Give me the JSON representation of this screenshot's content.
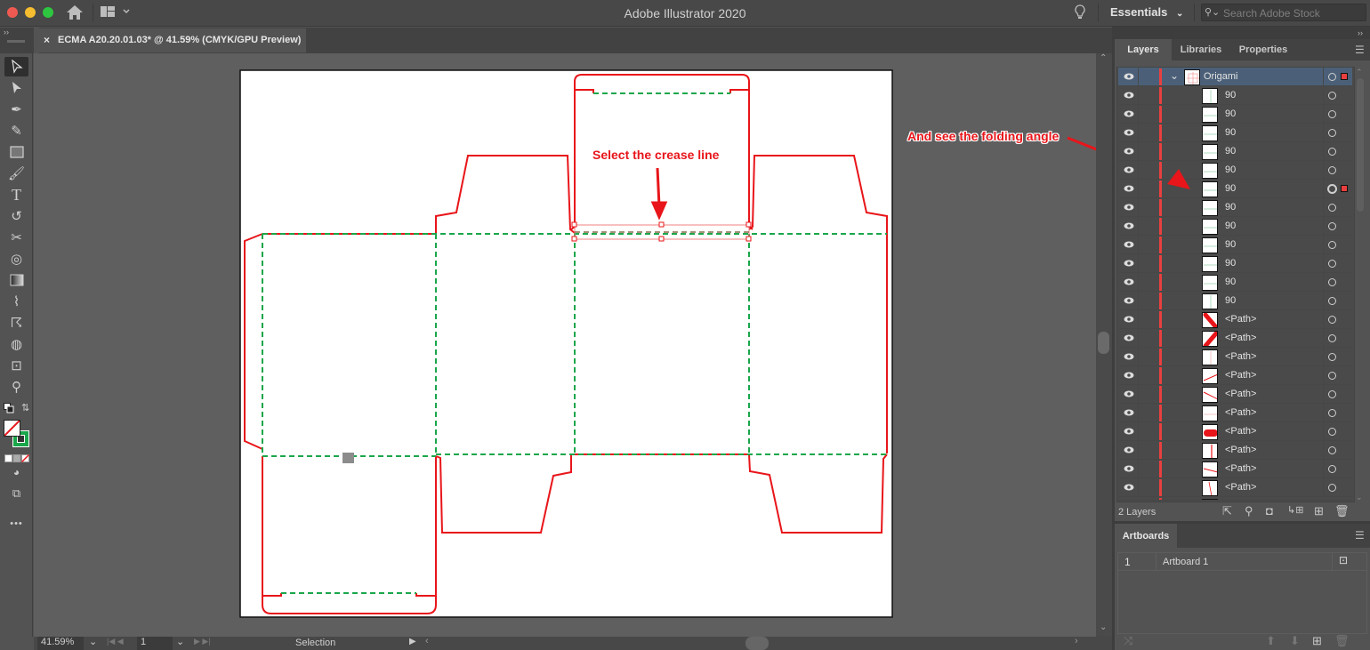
{
  "window": {
    "app_title": "Adobe Illustrator 2020",
    "traffic_lights": {
      "close": "#ee5a52",
      "minimize": "#f5bd2f",
      "maximize": "#2ec640"
    }
  },
  "header": {
    "home_icon": "home-icon",
    "workspace_switcher_icon": "layout-icon",
    "lightbulb_icon": "lightbulb-icon",
    "workspace_label": "Essentials",
    "search_placeholder": "Search Adobe Stock"
  },
  "document_tab": {
    "close_label": "×",
    "title": "ECMA A20.20.01.03* @ 41.59% (CMYK/GPU Preview)"
  },
  "toolbar": {
    "tools": [
      {
        "name": "selection-tool",
        "glyph": "➤",
        "active": true
      },
      {
        "name": "direct-selection-tool",
        "glyph": "▶"
      },
      {
        "name": "pen-tool",
        "glyph": "✒"
      },
      {
        "name": "curvature-tool",
        "glyph": "✎"
      },
      {
        "name": "rectangle-tool",
        "glyph": "▭"
      },
      {
        "name": "paintbrush-tool",
        "glyph": "🖌"
      },
      {
        "name": "type-tool",
        "glyph": "T"
      },
      {
        "name": "rotate-tool",
        "glyph": "↺"
      },
      {
        "name": "scissors-tool",
        "glyph": "✂"
      },
      {
        "name": "shape-builder-tool",
        "glyph": "◎"
      },
      {
        "name": "gradient-tool",
        "glyph": "▦"
      },
      {
        "name": "eyedropper-tool",
        "glyph": "⌇"
      },
      {
        "name": "puppet-warp-tool",
        "glyph": "☈"
      },
      {
        "name": "shaper-tool",
        "glyph": "◍"
      },
      {
        "name": "artboard-tool",
        "glyph": "⊡"
      },
      {
        "name": "zoom-tool",
        "glyph": "⚲"
      }
    ],
    "more_label": "•••",
    "stroke_color": "#1aa64b"
  },
  "canvas": {
    "annotations": {
      "crease": "Select the crease line",
      "angle": "And see the folding angle"
    },
    "cut_color": "#e8151a",
    "crease_color": "#1aa64b"
  },
  "status_bar": {
    "zoom": "41.59%",
    "artboard_number": "1",
    "tool_name": "Selection"
  },
  "layers_panel": {
    "tabs": [
      "Layers",
      "Libraries",
      "Properties"
    ],
    "active_tab": "Layers",
    "parent_layer": "Origami",
    "rows": [
      {
        "name": "90",
        "thumb": "v-line",
        "selected": false
      },
      {
        "name": "90",
        "thumb": "h-line",
        "selected": false
      },
      {
        "name": "90",
        "thumb": "h-line",
        "selected": false
      },
      {
        "name": "90",
        "thumb": "h-line",
        "selected": false
      },
      {
        "name": "90",
        "thumb": "h-line",
        "selected": false
      },
      {
        "name": "90",
        "thumb": "h-line",
        "selected": true
      },
      {
        "name": "90",
        "thumb": "h-line",
        "selected": false
      },
      {
        "name": "90",
        "thumb": "h-line",
        "selected": false
      },
      {
        "name": "90",
        "thumb": "h-line",
        "selected": false
      },
      {
        "name": "90",
        "thumb": "h-line",
        "selected": false
      },
      {
        "name": "90",
        "thumb": "h-line",
        "selected": false
      },
      {
        "name": "90",
        "thumb": "v-line",
        "selected": false
      },
      {
        "name": "<Path>",
        "thumb": "diag-thick-down",
        "selected": false
      },
      {
        "name": "<Path>",
        "thumb": "diag-thick-up",
        "selected": false
      },
      {
        "name": "<Path>",
        "thumb": "v-faint",
        "selected": false
      },
      {
        "name": "<Path>",
        "thumb": "diag-up",
        "selected": false
      },
      {
        "name": "<Path>",
        "thumb": "diag-down",
        "selected": false
      },
      {
        "name": "<Path>",
        "thumb": "h-faint",
        "selected": false
      },
      {
        "name": "<Path>",
        "thumb": "pill",
        "selected": false
      },
      {
        "name": "<Path>",
        "thumb": "v-red",
        "selected": false
      },
      {
        "name": "<Path>",
        "thumb": "slight-down",
        "selected": false
      },
      {
        "name": "<Path>",
        "thumb": "steep",
        "selected": false
      }
    ],
    "layer_count": "2 Layers",
    "footer_icons": [
      "export-icon",
      "locate-icon",
      "clipping-mask-icon",
      "new-sublayer-icon",
      "new-layer-icon",
      "trash-icon"
    ],
    "layer_color": "#e9403f"
  },
  "artboards_panel": {
    "title": "Artboards",
    "rows": [
      {
        "number": "1",
        "name": "Artboard 1"
      }
    ]
  }
}
